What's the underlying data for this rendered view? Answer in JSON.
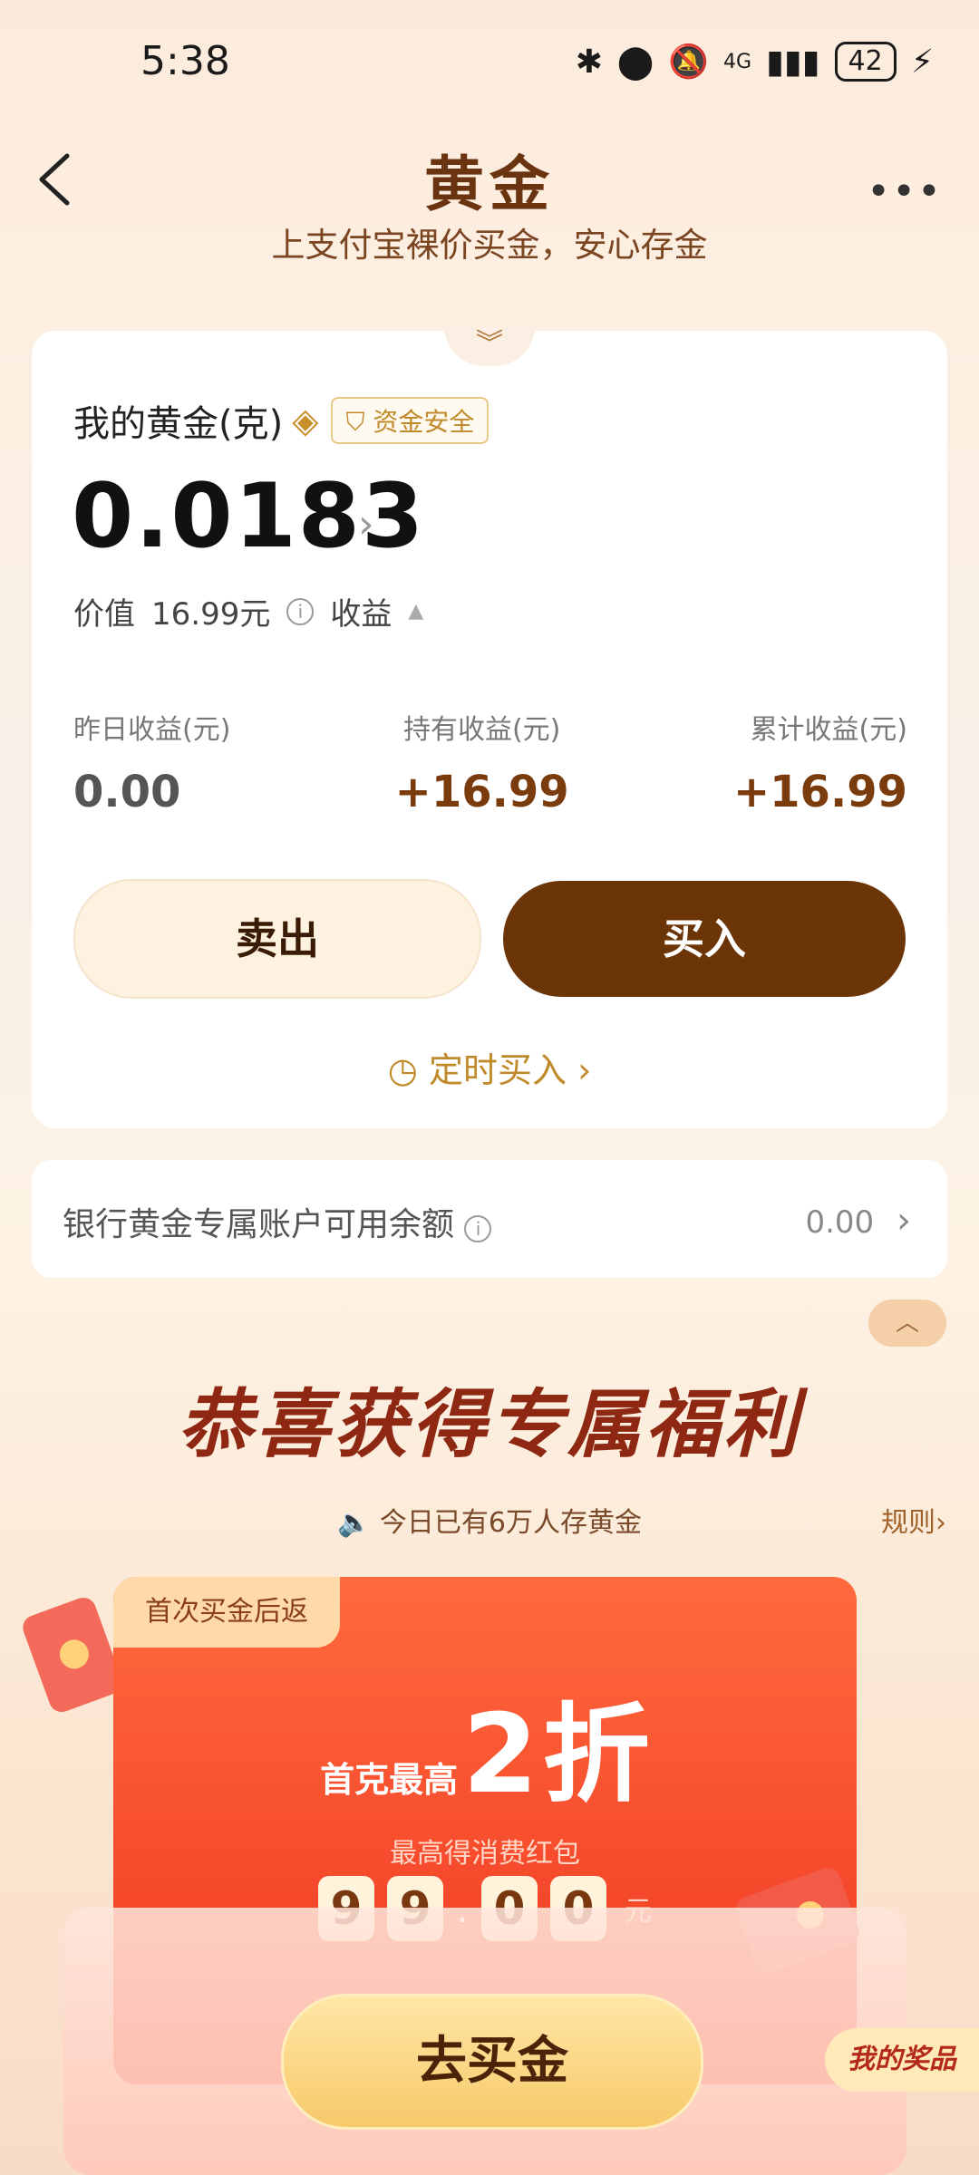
{
  "status_bar": {
    "time": "5:38",
    "signal": "4G",
    "battery": "42"
  },
  "header": {
    "title": "黄金",
    "subtitle": "上支付宝裸价买金，安心存金"
  },
  "gold_card": {
    "label": "我的黄金(克)",
    "safety_badge": "资金安全",
    "amount": "0.0183",
    "value_label": "价值",
    "value": "16.99元",
    "earnings_label": "收益",
    "stats": [
      {
        "label": "昨日收益(元)",
        "value": "0.00"
      },
      {
        "label": "持有收益(元)",
        "value": "+16.99"
      },
      {
        "label": "累计收益(元)",
        "value": "+16.99"
      }
    ],
    "sell_label": "卖出",
    "buy_label": "买入",
    "scheduled_label": "定时买入"
  },
  "bank_account": {
    "label": "银行黄金专属账户可用余额",
    "value": "0.00"
  },
  "promo": {
    "congrats": "恭喜获得专属福利",
    "people": "今日已有6万人存黄金",
    "rules": "规则",
    "tag": "首次买金后返",
    "headline_a": "首克最高",
    "headline_b": "2",
    "headline_c": "折",
    "sub": "最高得消费红包",
    "digits": [
      "9",
      "9",
      "0",
      "0"
    ],
    "unit": "元",
    "button": "去买金",
    "prizes": "我的奖品"
  },
  "colors": {
    "brown": "#6b3508",
    "gold": "#c08a2a",
    "promo_red": "#f64a2c"
  }
}
